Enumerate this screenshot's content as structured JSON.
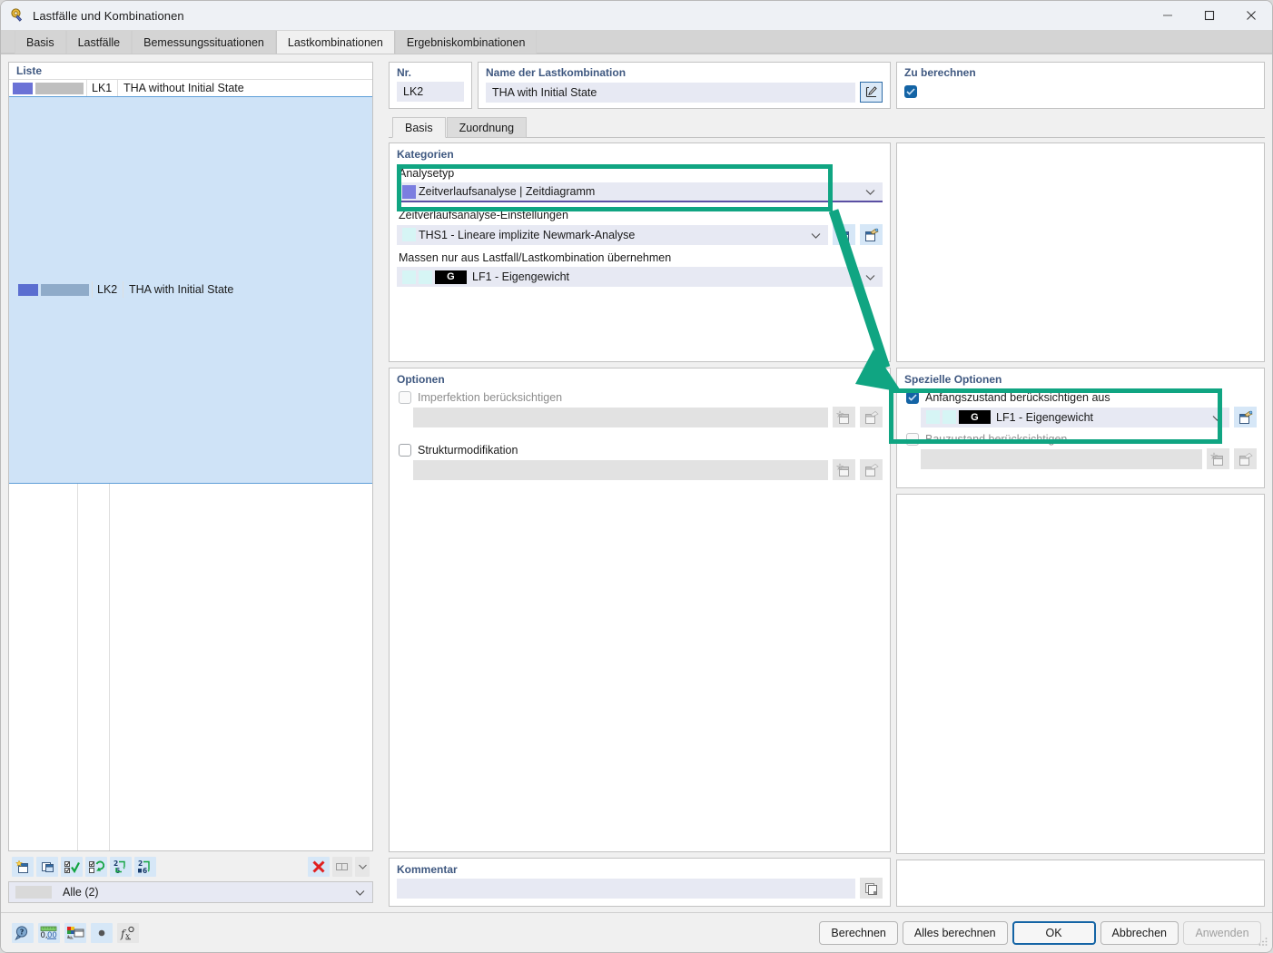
{
  "window": {
    "title": "Lastfälle und Kombinationen",
    "icon": "lock-key-icon",
    "controls": {
      "minimize": "minimize-icon",
      "maximize": "maximize-icon",
      "close": "close-icon"
    }
  },
  "tabs": [
    {
      "label": "Basis",
      "active": false
    },
    {
      "label": "Lastfälle",
      "active": false
    },
    {
      "label": "Bemessungssituationen",
      "active": false
    },
    {
      "label": "Lastkombinationen",
      "active": true
    },
    {
      "label": "Ergebniskombinationen",
      "active": false
    }
  ],
  "list": {
    "header": "Liste",
    "rows": [
      {
        "no": "LK1",
        "name": "THA without Initial State",
        "color1": "#6b72d6",
        "color2": "#bfbfbf",
        "selected": false
      },
      {
        "no": "LK2",
        "name": "THA with Initial State",
        "color1": "#5b6ed0",
        "color2": "#8fabc9",
        "selected": true
      }
    ],
    "toolbar": [
      {
        "name": "new-item-button",
        "icon": "new-document-icon"
      },
      {
        "name": "copy-item-button",
        "icon": "copy-icon"
      },
      {
        "name": "select-all-button",
        "icon": "checkbox-check-icon"
      },
      {
        "name": "invert-selection-button",
        "icon": "checkbox-swap-icon"
      },
      {
        "name": "renumber-button",
        "icon": "renumber-icon"
      },
      {
        "name": "reorder-button",
        "icon": "reorder-icon"
      },
      {
        "name": "delete-button",
        "icon": "delete-x-icon"
      },
      {
        "name": "view-mode-button",
        "icon": "columns-icon"
      },
      {
        "name": "view-mode-dropdown",
        "icon": "chevron-down-icon"
      }
    ],
    "filter": {
      "value": "Alle (2)",
      "swatch": "#d9d9d9"
    }
  },
  "header": {
    "nr": {
      "label": "Nr.",
      "value": "LK2"
    },
    "name": {
      "label": "Name der Lastkombination",
      "value": "THA with Initial State",
      "edit_icon": "edit-pencil-icon"
    },
    "to_calculate": {
      "label": "Zu berechnen",
      "checked": true
    }
  },
  "inner_tabs": [
    {
      "label": "Basis",
      "active": true
    },
    {
      "label": "Zuordnung",
      "active": false
    }
  ],
  "categories": {
    "title": "Kategorien",
    "analysis_type": {
      "label": "Analysetyp",
      "value": "Zeitverlaufsanalyse | Zeitdiagramm",
      "chip_color": "#7b7ee0",
      "highlighted": true
    },
    "settings": {
      "label": "Zeitverlaufsanalyse-Einstellungen",
      "value": "THS1 - Lineare implizite Newmark-Analyse",
      "chip_color": "#d6f5f5",
      "buttons": [
        {
          "name": "new-settings-button",
          "icon": "new-document-icon"
        },
        {
          "name": "edit-settings-button",
          "icon": "edit-document-icon"
        }
      ]
    },
    "masses": {
      "label": "Massen nur aus Lastfall/Lastkombination übernehmen",
      "tag": "G",
      "value": "LF1 - Eigengewicht",
      "chip_color": "#d6f5f5",
      "chip2_color": "#d6f5f5"
    }
  },
  "options": {
    "title": "Optionen",
    "items": [
      {
        "label": "Imperfektion berücksichtigen",
        "checked": false,
        "disabled": true,
        "buttons": [
          {
            "name": "new-imperfection-button",
            "icon": "new-document-icon"
          },
          {
            "name": "edit-imperfection-button",
            "icon": "edit-document-icon"
          }
        ]
      },
      {
        "label": "Strukturmodifikation",
        "checked": false,
        "disabled": false,
        "buttons": [
          {
            "name": "new-modification-button",
            "icon": "new-document-icon"
          },
          {
            "name": "edit-modification-button",
            "icon": "edit-document-icon"
          }
        ]
      }
    ]
  },
  "special_options": {
    "title": "Spezielle Optionen",
    "initial_state": {
      "label": "Anfangszustand berücksichtigen aus",
      "checked": true,
      "tag": "G",
      "value": "LF1 - Eigengewicht",
      "chip_color": "#d6f5f5",
      "chip2_color": "#d6f5f5",
      "highlighted": true,
      "button": {
        "name": "edit-initial-state-button",
        "icon": "edit-document-icon"
      }
    },
    "construction_stage": {
      "label": "Bauzustand berücksichtigen",
      "checked": false,
      "disabled": true,
      "buttons": [
        {
          "name": "new-stage-button",
          "icon": "new-document-icon"
        },
        {
          "name": "edit-stage-button",
          "icon": "edit-document-icon"
        }
      ]
    }
  },
  "comment": {
    "title": "Kommentar",
    "value": "",
    "button": {
      "name": "comment-library-button",
      "icon": "copy-pages-icon"
    }
  },
  "statusbar_tools": [
    {
      "name": "help-search-button",
      "icon": "magnifier-question-icon"
    },
    {
      "name": "units-button",
      "icon": "decimal-units-icon"
    },
    {
      "name": "render-settings-button",
      "icon": "colors-window-icon"
    },
    {
      "name": "dot-button",
      "icon": "dot-icon"
    },
    {
      "name": "formula-button",
      "icon": "function-fx-icon"
    }
  ],
  "footer_buttons": [
    {
      "label": "Berechnen",
      "name": "calculate-button",
      "style": "normal"
    },
    {
      "label": "Alles berechnen",
      "name": "calculate-all-button",
      "style": "normal"
    },
    {
      "label": "OK",
      "name": "ok-button",
      "style": "primary"
    },
    {
      "label": "Abbrechen",
      "name": "cancel-button",
      "style": "normal"
    },
    {
      "label": "Anwenden",
      "name": "apply-button",
      "style": "disabled"
    }
  ],
  "annotation": {
    "color": "#10a582",
    "boxes": [
      {
        "name": "analysetyp-highlight"
      },
      {
        "name": "anfangszustand-highlight"
      }
    ],
    "arrow": {
      "name": "annotation-arrow",
      "from": "analysetyp-highlight",
      "to": "spezielle-optionen"
    }
  }
}
